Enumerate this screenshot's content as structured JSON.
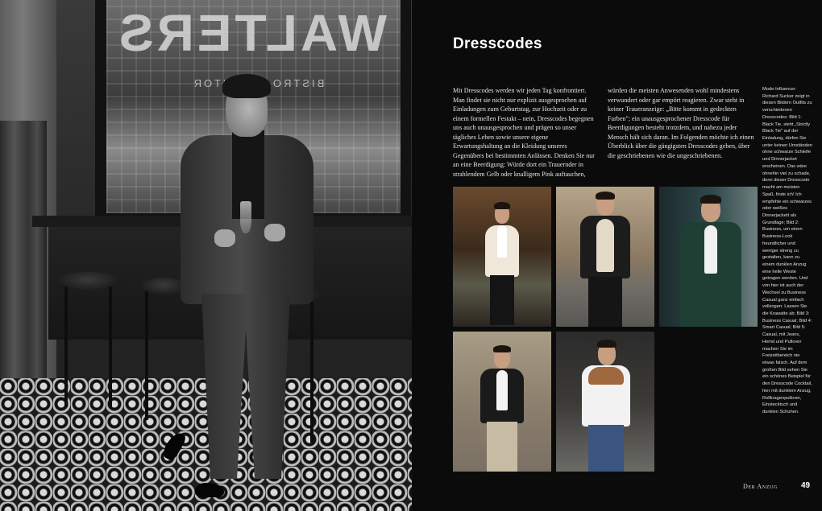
{
  "hero": {
    "sign_text": "WALTERS",
    "sign_subtext": "BISTRO & KONTOR"
  },
  "article": {
    "title": "Dresscodes",
    "col1": "Mit Dresscodes werden wir jeden Tag konfrontiert. Man findet sie nicht nur explizit ausgesprochen auf Einladungen zum Geburtstag, zur Hochzeit oder zu einem formellen Festakt – nein, Dresscodes begegnen uns auch unausgesprochen und prägen so unser tägliches Leben sowie unsere eigene Erwartungshaltung an die Kleidung unseres Gegenübers bei bestimmten Anlässen. Denken Sie nur an eine Beerdigung: Würde dort ein Trauernder in strahlendem Gelb oder knalligem Pink auftauchen,",
    "col2": "würden die meisten Anwesenden wohl mindestens verwundert oder gar empört reagieren. Zwar steht in keiner Traueranzeige: „Bitte kommt in gedeckten Farben\"; ein unausgesprochener Dresscode für Beerdigungen besteht trotzdem, und nahezu jeder Mensch hält sich daran. Im Folgenden möchte ich einen Überblick über die gängigsten Dresscodes geben, über die geschriebenen wie die ungeschriebenen.",
    "sidebar": "Mode-Influencer Richard Sucker zeigt in diesen Bildern Outfits zu verschiedenen Dresscodes: Bild 1: Black Tie, steht „Strictly Black Tie\" auf der Einladung, dürfen Sie unter keinen Umständen ohne schwarze Schleife und Dinnerjacket erscheinen. Das wäre ohnehin viel zu schade, denn dieser Dresscode macht am meisten Spaß, finde ich! Ich empfehle ein schwarzes oder weißes Dinnerjackett als Grundlage; Bild 2: Business, um einen Business-Look freundlicher und weniger streng zu gestalten, kann zu einem dunklen Anzug eine helle Weste getragen werden. Und von hier ist auch der Wechsel zu Business Casual ganz einfach vollzogen: Lassen Sie die Krawatte ab; Bild 3: Business Casual; Bild 4: Smart Casual; Bild 5: Casual, mit Jeans, Hemd und Pullover machen Sie im Freizeitbereich nie etwas falsch. Auf dem großen Bild sehen Sie ein schönes Beispiel für den Dresscode Cocktail, hier mit dunklem Anzug, Rollkragenpullover, Einstecktuch und dunklen Schuhen."
  },
  "footer": {
    "section": "Der Anzug",
    "page_number": "49"
  }
}
